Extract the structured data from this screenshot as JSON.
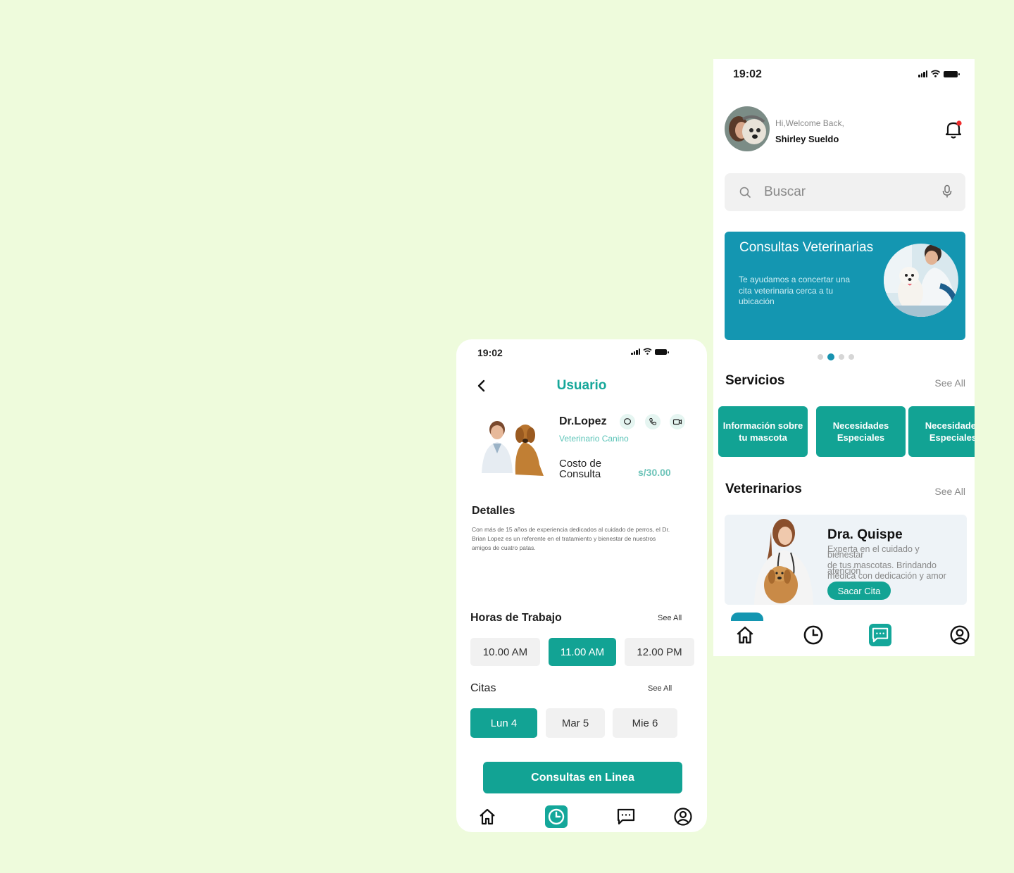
{
  "colors": {
    "page_bg": "#eefbdc",
    "primary": "#12a394",
    "banner": "#1496b1",
    "accent_text": "#16a79a"
  },
  "left_screen": {
    "status_time": "19:02",
    "title": "Usuario",
    "doctor": {
      "name": "Dr.Lopez",
      "specialty": "Veterinario Canino",
      "cost_label": "Costo de Consulta",
      "cost_value": "s/30.00"
    },
    "details": {
      "title": "Detalles",
      "text": "Con más de 15 años de experiencia dedicados al cuidado de perros, el Dr. Brian Lopez es un referente en el tratamiento y bienestar de nuestros amigos de cuatro patas."
    },
    "hours": {
      "title": "Horas de Trabajo",
      "see_all": "See All",
      "slots": [
        "10.00 AM",
        "11.00 AM",
        "12.00 PM"
      ],
      "selected": "11.00 AM"
    },
    "appointments": {
      "title": "Citas",
      "see_all": "See All",
      "days": [
        "Lun 4",
        "Mar 5",
        "Mie 6"
      ],
      "selected": "Lun 4"
    },
    "cta": "Consultas en Linea",
    "nav": [
      "home-icon",
      "clock-icon",
      "chat-icon",
      "profile-icon"
    ],
    "nav_active": "clock-icon"
  },
  "right_screen": {
    "status_time": "19:02",
    "greeting": "Hi,Welcome Back,",
    "user_name": "Shirley Sueldo",
    "search_placeholder": "Buscar",
    "banner": {
      "title": "Consultas Veterinarias",
      "text": "Te ayudamos a concertar una cita veterinaria cerca a tu ubicación"
    },
    "carousel": {
      "count": 4,
      "active_index": 1
    },
    "services": {
      "title": "Servicios",
      "see_all": "See All",
      "items": [
        "Información sobre tu mascota",
        "Necesidades Especiales",
        "Necesidades Especiales"
      ]
    },
    "vets": {
      "title": "Veterinarios",
      "see_all": "See All",
      "name": "Dra. Quispe",
      "line1": "Experta en el cuidado y",
      "line2": "bienestar",
      "line3": "de tus mascotas. Brindando",
      "line4": "atención",
      "line5": "médica con dedicación y amor",
      "button": "Sacar Cita"
    },
    "nav": [
      "home-icon",
      "clock-icon",
      "chat-icon",
      "profile-icon"
    ],
    "nav_active": "chat-icon"
  }
}
